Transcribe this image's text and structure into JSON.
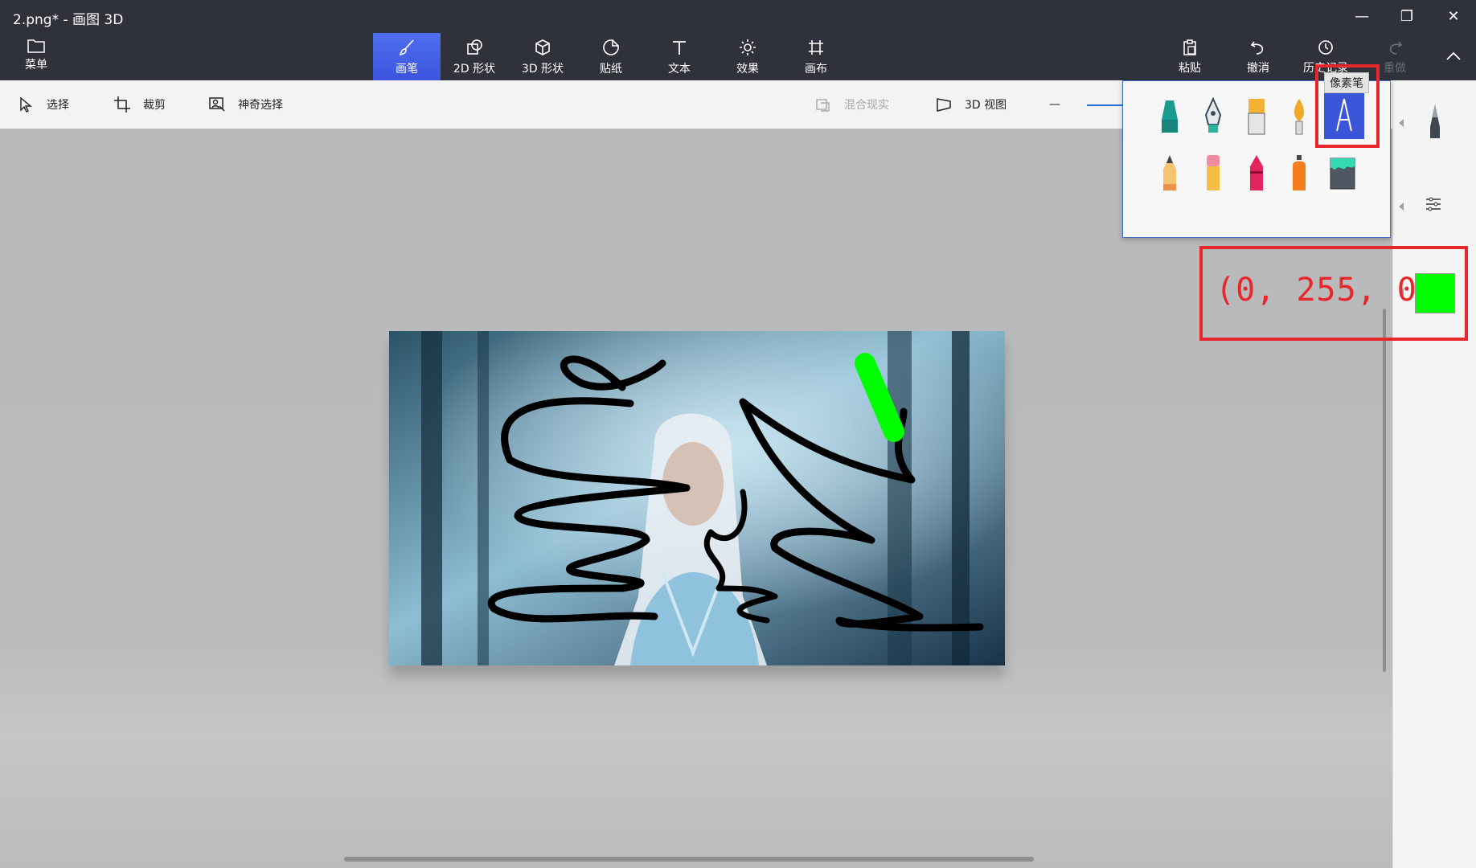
{
  "window": {
    "title": "2.png* - 画图 3D",
    "minimize_glyph": "—",
    "restore_glyph": "❐",
    "close_glyph": "✕"
  },
  "menu": {
    "label": "菜单",
    "icon": "folder-icon"
  },
  "ribbon_tools": [
    {
      "label": "画笔",
      "icon": "brush-icon",
      "active": true
    },
    {
      "label": "2D 形状",
      "icon": "shapes-2d-icon"
    },
    {
      "label": "3D 形状",
      "icon": "cube-icon"
    },
    {
      "label": "贴纸",
      "icon": "sticker-icon"
    },
    {
      "label": "文本",
      "icon": "text-icon"
    },
    {
      "label": "效果",
      "icon": "sun-icon"
    },
    {
      "label": "画布",
      "icon": "canvas-icon"
    }
  ],
  "right_tools": [
    {
      "label": "粘贴",
      "icon": "paste-icon"
    },
    {
      "label": "撤消",
      "icon": "undo-icon"
    },
    {
      "label": "历史记录",
      "icon": "history-icon"
    },
    {
      "label": "重做",
      "icon": "redo-icon",
      "disabled": true
    }
  ],
  "subtoolbar": {
    "select": "选择",
    "crop": "裁剪",
    "magic_select": "神奇选择",
    "mixed_reality": "混合现实",
    "view_3d": "3D 视图",
    "zoom_out_glyph": "—"
  },
  "brush_popup": {
    "tooltip": "像素笔",
    "selected_index": 4,
    "brushes": [
      "marker-icon",
      "calligraphy-pen-icon",
      "oil-brush-icon",
      "watercolor-icon",
      "pixel-pen-icon",
      "pencil-icon",
      "eraser-icon",
      "crayon-icon",
      "spray-can-icon",
      "fill-bucket-icon"
    ]
  },
  "color": {
    "annotation": "(0, 255, 0)",
    "current": "#00ff00"
  },
  "accent": "#3d53de",
  "annotation_color": "#e8262b"
}
